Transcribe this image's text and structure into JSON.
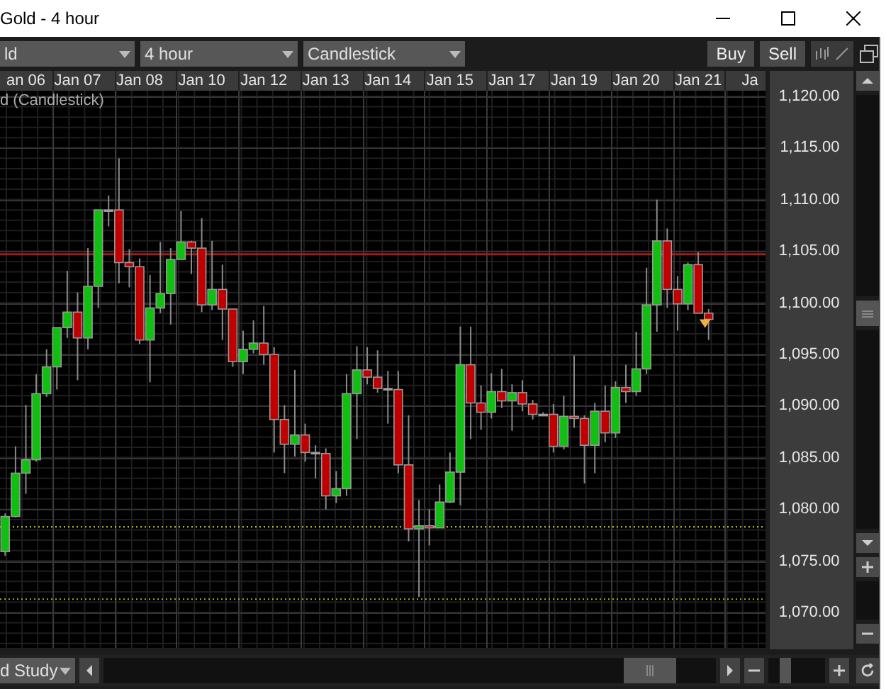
{
  "window": {
    "title": "Gold - 4 hour"
  },
  "toolbar": {
    "dropdowns": [
      {
        "value": "ld"
      },
      {
        "value": "4 hour"
      },
      {
        "value": "Candlestick"
      }
    ],
    "buttons": [
      "Buy",
      "Sell"
    ]
  },
  "chart": {
    "legend": "d (Candlestick)",
    "chart_data": {
      "type": "candlestick",
      "ylim": [
        1066.57,
        1120.55
      ],
      "grid": true,
      "categories": [
        null,
        null,
        "an 06",
        null,
        null,
        null,
        null,
        "Jan 07",
        null,
        null,
        null,
        null,
        null,
        "Jan 08",
        null,
        null,
        null,
        null,
        null,
        "Jan 10",
        null,
        null,
        null,
        null,
        null,
        "Jan 12",
        null,
        null,
        null,
        null,
        null,
        "Jan 13",
        null,
        null,
        null,
        null,
        null,
        "Jan 14",
        null,
        null,
        null,
        null,
        null,
        "Jan 15",
        null,
        null,
        null,
        null,
        null,
        "Jan 17",
        null,
        null,
        null,
        null,
        null,
        "Jan 19",
        null,
        null,
        null,
        null,
        null,
        "Jan 20",
        null,
        null,
        null,
        null,
        null,
        "Jan 21",
        null,
        null,
        null,
        null,
        "Ja",
        null
      ],
      "yticks": [
        {
          "value": 1120,
          "label": "1,120.00"
        },
        {
          "value": 1115,
          "label": "1,115.00"
        },
        {
          "value": 1110,
          "label": "1,110.00"
        },
        {
          "value": 1105,
          "label": "1,105.00"
        },
        {
          "value": 1100,
          "label": "1,100.00"
        },
        {
          "value": 1095,
          "label": "1,095.00"
        },
        {
          "value": 1090,
          "label": "1,090.00"
        },
        {
          "value": 1085,
          "label": "1,085.00"
        },
        {
          "value": 1080,
          "label": "1,080.00"
        },
        {
          "value": 1075,
          "label": "1,075.00"
        },
        {
          "value": 1070,
          "label": "1,070.00"
        }
      ],
      "ohlc": [
        [
          1075.9,
          1079.6,
          1075.5,
          1079.3
        ],
        [
          1079.3,
          1086.1,
          1079.2,
          1083.5
        ],
        [
          1083.5,
          1090.1,
          1081.5,
          1084.8
        ],
        [
          1084.8,
          1093.1,
          1084.6,
          1091.2
        ],
        [
          1091.2,
          1095.5,
          1090.9,
          1093.8
        ],
        [
          1093.8,
          1097.6,
          1091.6,
          1097.6
        ],
        [
          1097.6,
          1103.1,
          1096.6,
          1099.1
        ],
        [
          1099.1,
          1101.0,
          1092.5,
          1096.6
        ],
        [
          1096.6,
          1105.3,
          1095.5,
          1101.6
        ],
        [
          1101.6,
          1109.0,
          1099.5,
          1109.0
        ],
        [
          1109.0,
          1110.4,
          1107.4,
          1108.9
        ],
        [
          1109.0,
          1114.0,
          1101.9,
          1103.9
        ],
        [
          1103.9,
          1105.2,
          1101.5,
          1103.5
        ],
        [
          1103.5,
          1104.3,
          1096.0,
          1096.4
        ],
        [
          1096.4,
          1102.7,
          1092.3,
          1099.5
        ],
        [
          1099.5,
          1105.9,
          1099.0,
          1100.9
        ],
        [
          1100.9,
          1105.3,
          1097.9,
          1104.2
        ],
        [
          1104.2,
          1108.9,
          1104.2,
          1105.9
        ],
        [
          1105.9,
          1106.0,
          1102.8,
          1105.3
        ],
        [
          1105.3,
          1108.2,
          1099.1,
          1099.8
        ],
        [
          1099.8,
          1106.0,
          1099.3,
          1101.3
        ],
        [
          1101.3,
          1103.7,
          1096.4,
          1099.4
        ],
        [
          1099.4,
          1099.4,
          1093.8,
          1094.3
        ],
        [
          1094.3,
          1097.3,
          1093.1,
          1095.5
        ],
        [
          1095.5,
          1098.3,
          1095.1,
          1096.1
        ],
        [
          1096.1,
          1099.7,
          1094.0,
          1095.0
        ],
        [
          1095.0,
          1095.7,
          1085.5,
          1088.7
        ],
        [
          1088.7,
          1090.1,
          1083.5,
          1086.3
        ],
        [
          1086.3,
          1093.5,
          1085.1,
          1087.2
        ],
        [
          1087.2,
          1088.3,
          1084.6,
          1085.5
        ],
        [
          1085.5,
          1086.2,
          1083.0,
          1085.4
        ],
        [
          1085.4,
          1085.9,
          1080.0,
          1081.3
        ],
        [
          1081.3,
          1083.7,
          1080.6,
          1082.0
        ],
        [
          1082.0,
          1093.1,
          1081.3,
          1091.2
        ],
        [
          1091.2,
          1095.8,
          1086.8,
          1093.5
        ],
        [
          1093.5,
          1095.7,
          1092.1,
          1092.8
        ],
        [
          1092.8,
          1095.4,
          1091.3,
          1091.7
        ],
        [
          1091.7,
          1093.4,
          1088.3,
          1091.6
        ],
        [
          1091.6,
          1093.4,
          1083.5,
          1084.3
        ],
        [
          1084.3,
          1089.1,
          1076.9,
          1078.1
        ],
        [
          1078.1,
          1080.9,
          1071.5,
          1078.4
        ],
        [
          1078.4,
          1080.0,
          1076.5,
          1078.2
        ],
        [
          1078.2,
          1082.4,
          1078.2,
          1080.7
        ],
        [
          1080.7,
          1085.5,
          1080.6,
          1083.6
        ],
        [
          1083.6,
          1097.7,
          1080.4,
          1094.0
        ],
        [
          1094.0,
          1097.7,
          1086.8,
          1090.3
        ],
        [
          1090.3,
          1092.0,
          1087.7,
          1089.4
        ],
        [
          1089.4,
          1093.2,
          1088.8,
          1091.4
        ],
        [
          1091.4,
          1093.6,
          1089.8,
          1090.5
        ],
        [
          1090.5,
          1092.1,
          1087.6,
          1091.3
        ],
        [
          1091.3,
          1092.5,
          1089.5,
          1090.2
        ],
        [
          1090.2,
          1090.6,
          1088.7,
          1089.2
        ],
        [
          1089.2,
          1089.4,
          1089.1,
          1089.1
        ],
        [
          1089.2,
          1090.2,
          1085.5,
          1086.1
        ],
        [
          1086.1,
          1091.0,
          1085.8,
          1089.0
        ],
        [
          1089.0,
          1094.9,
          1087.9,
          1088.8
        ],
        [
          1088.8,
          1089.1,
          1082.5,
          1086.2
        ],
        [
          1086.2,
          1090.3,
          1083.5,
          1089.5
        ],
        [
          1089.5,
          1092.0,
          1086.5,
          1087.4
        ],
        [
          1087.4,
          1092.4,
          1086.9,
          1091.8
        ],
        [
          1091.8,
          1094.0,
          1090.3,
          1091.4
        ],
        [
          1091.4,
          1097.2,
          1091.0,
          1093.6
        ],
        [
          1093.6,
          1103.4,
          1093.1,
          1099.8
        ],
        [
          1099.8,
          1110.0,
          1097.2,
          1106.0
        ],
        [
          1106.0,
          1107.2,
          1099.5,
          1101.3
        ],
        [
          1101.3,
          1102.6,
          1097.3,
          1099.9
        ],
        [
          1099.9,
          1103.9,
          1099.3,
          1103.7
        ],
        [
          1103.7,
          1104.9,
          1099.0,
          1099.0
        ],
        [
          1099.0,
          1099.4,
          1096.4,
          1098.4
        ],
        null,
        null,
        null,
        null,
        null
      ],
      "ref_lines": [
        {
          "axis": "y",
          "value": 1104.7
        },
        {
          "axis": "y",
          "value": 1078.3
        },
        {
          "axis": "y",
          "value": 1071.3
        }
      ]
    }
  },
  "bottom_bar": {
    "study_dropdown": "d Study"
  }
}
